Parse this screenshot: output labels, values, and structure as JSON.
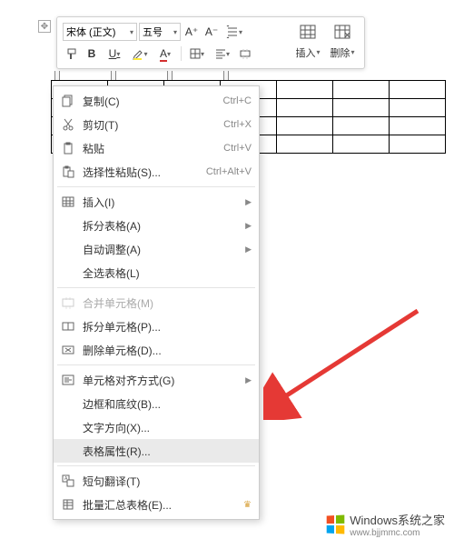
{
  "toolbar": {
    "font_name": "宋体 (正文)",
    "font_size": "五号",
    "grow_font": "A⁺",
    "shrink_font": "A⁻",
    "insert_label": "插入",
    "delete_label": "删除"
  },
  "context_menu": {
    "copy": {
      "label": "复制(C)",
      "shortcut": "Ctrl+C"
    },
    "cut": {
      "label": "剪切(T)",
      "shortcut": "Ctrl+X"
    },
    "paste": {
      "label": "粘贴",
      "shortcut": "Ctrl+V"
    },
    "paste_special": {
      "label": "选择性粘贴(S)...",
      "shortcut": "Ctrl+Alt+V"
    },
    "insert": {
      "label": "插入(I)"
    },
    "split_table": {
      "label": "拆分表格(A)"
    },
    "auto_adjust": {
      "label": "自动调整(A)"
    },
    "select_table": {
      "label": "全选表格(L)"
    },
    "merge_cells": {
      "label": "合并单元格(M)"
    },
    "split_cells": {
      "label": "拆分单元格(P)..."
    },
    "delete_cells": {
      "label": "删除单元格(D)..."
    },
    "cell_align": {
      "label": "单元格对齐方式(G)"
    },
    "borders": {
      "label": "边框和底纹(B)..."
    },
    "text_direction": {
      "label": "文字方向(X)..."
    },
    "table_props": {
      "label": "表格属性(R)..."
    },
    "sentence_translate": {
      "label": "短句翻译(T)"
    },
    "batch_summary": {
      "label": "批量汇总表格(E)..."
    }
  },
  "watermark": {
    "brand": "Windows",
    "site": "系统之家",
    "url": "www.bjjmmc.com"
  }
}
